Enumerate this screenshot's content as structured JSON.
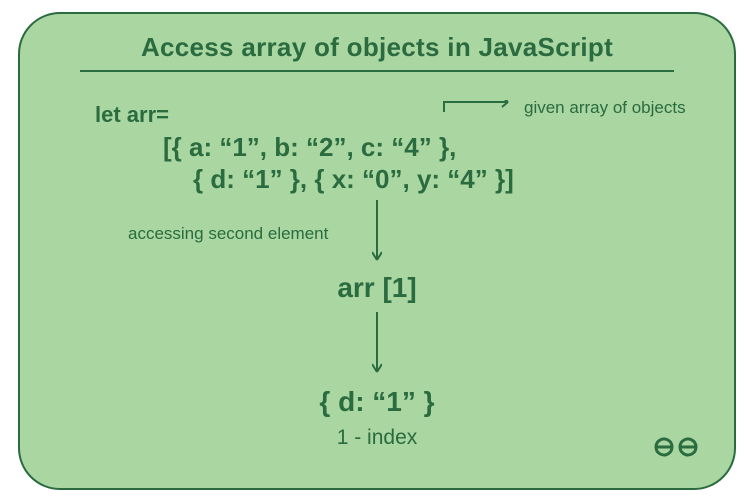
{
  "title": "Access array of objects in JavaScript",
  "let_label": "let arr=",
  "code_line1": "[{ a: “1”, b: “2”, c: “4” },",
  "code_line2": "{ d: “1” }, { x: “0”, y: “4” }]",
  "given_label": "given array of objects",
  "access_label": "accessing second element",
  "access_expr": "arr [1]",
  "result": "{ d: “1” }",
  "index_label": "1 - index",
  "colors": {
    "bg": "#a9d6a1",
    "fg": "#2a6b3f"
  }
}
